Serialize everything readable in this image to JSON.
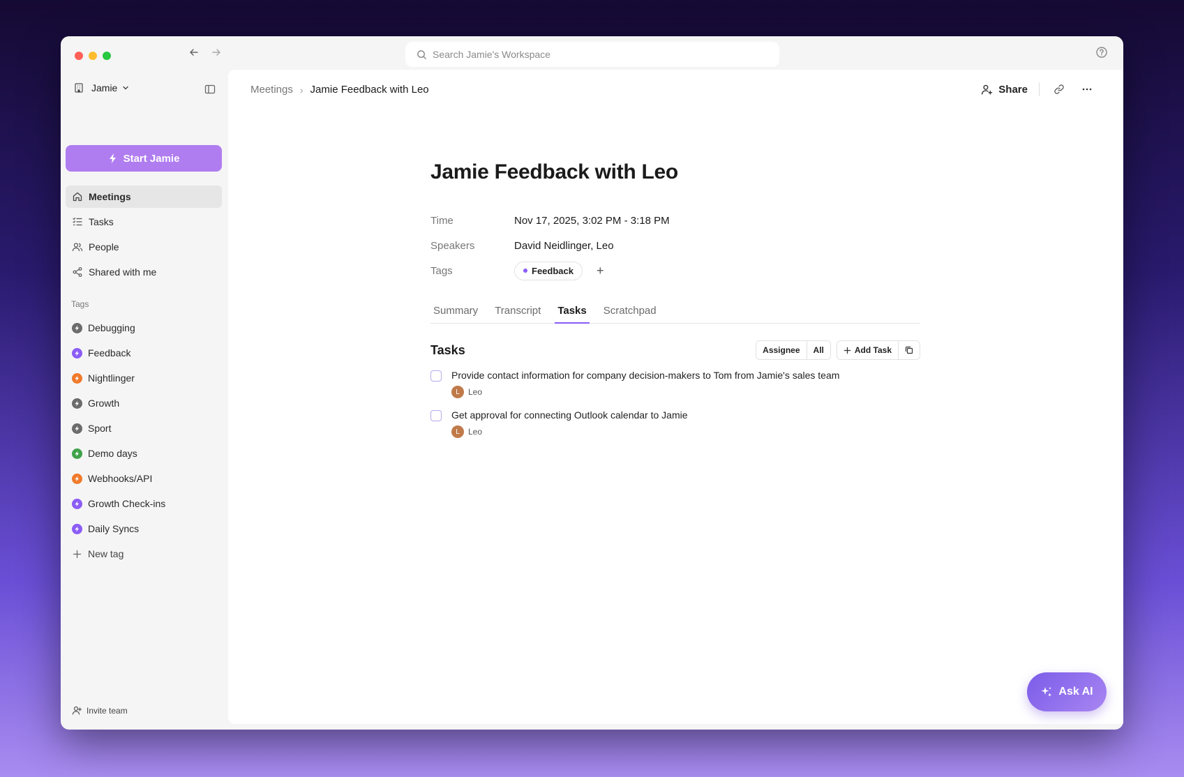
{
  "search": {
    "placeholder": "Search Jamie's Workspace"
  },
  "workspace": {
    "name": "Jamie"
  },
  "sidebar": {
    "start_label": "Start Jamie",
    "nav": [
      {
        "label": "Meetings",
        "icon": "home-icon"
      },
      {
        "label": "Tasks",
        "icon": "tasks-icon"
      },
      {
        "label": "People",
        "icon": "people-icon"
      },
      {
        "label": "Shared with me",
        "icon": "share-icon"
      }
    ],
    "tags_heading": "Tags",
    "tags": [
      {
        "label": "Debugging",
        "color": "#6b6b6b"
      },
      {
        "label": "Feedback",
        "color": "#8b5cf6"
      },
      {
        "label": "Nightlinger",
        "color": "#f07a2a"
      },
      {
        "label": "Growth",
        "color": "#6b6b6b"
      },
      {
        "label": "Sport",
        "color": "#6b6b6b"
      },
      {
        "label": "Demo days",
        "color": "#3fa24a"
      },
      {
        "label": "Webhooks/API",
        "color": "#f07a2a"
      },
      {
        "label": "Growth Check-ins",
        "color": "#8b5cf6"
      },
      {
        "label": "Daily Syncs",
        "color": "#8b5cf6"
      }
    ],
    "new_tag_label": "New tag",
    "invite_label": "Invite team"
  },
  "breadcrumb": {
    "root": "Meetings",
    "current": "Jamie Feedback with Leo"
  },
  "actions": {
    "share_label": "Share"
  },
  "meeting": {
    "title": "Jamie Feedback with Leo",
    "time_label": "Time",
    "time_value": "Nov 17, 2025, 3:02 PM - 3:18 PM",
    "speakers_label": "Speakers",
    "speakers_value": "David Neidlinger, Leo",
    "tags_label": "Tags",
    "tag": "Feedback"
  },
  "tabs": [
    "Summary",
    "Transcript",
    "Tasks",
    "Scratchpad"
  ],
  "tasks": {
    "title": "Tasks",
    "assignee_label": "Assignee",
    "filter_label": "All",
    "add_label": "Add Task",
    "items": [
      {
        "text": "Provide contact information for company decision-makers to Tom from Jamie's sales team",
        "assignee": "Leo",
        "initial": "L"
      },
      {
        "text": "Get approval for connecting Outlook calendar to Jamie",
        "assignee": "Leo",
        "initial": "L"
      }
    ]
  },
  "ask_ai_label": "Ask AI",
  "colors": {
    "accent": "#8b5cf6",
    "start_button": "#b07df0"
  }
}
